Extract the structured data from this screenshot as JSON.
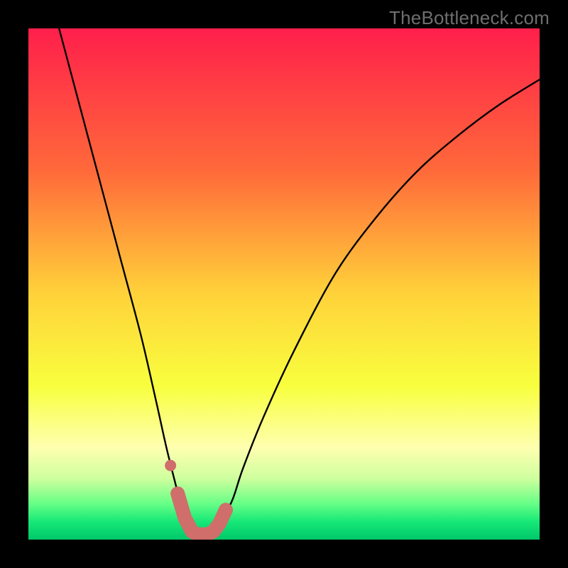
{
  "watermark": "TheBottleneck.com",
  "colors": {
    "black": "#000000",
    "curve": "#000000",
    "marker": "#cf6e6b",
    "gradient_stops": [
      {
        "offset": 0.0,
        "color": "#ff1f4b"
      },
      {
        "offset": 0.28,
        "color": "#ff6a3a"
      },
      {
        "offset": 0.52,
        "color": "#ffd23a"
      },
      {
        "offset": 0.7,
        "color": "#f8ff3e"
      },
      {
        "offset": 0.82,
        "color": "#feffb0"
      },
      {
        "offset": 0.88,
        "color": "#cfff9e"
      },
      {
        "offset": 0.93,
        "color": "#66ff86"
      },
      {
        "offset": 0.965,
        "color": "#17e877"
      },
      {
        "offset": 1.0,
        "color": "#00c86a"
      }
    ]
  },
  "chart_data": {
    "type": "line",
    "title": "",
    "xlabel": "",
    "ylabel": "",
    "xlim": [
      0,
      100
    ],
    "ylim": [
      0,
      100
    ],
    "grid": false,
    "legend": false,
    "series": [
      {
        "name": "bottleneck-curve",
        "x": [
          6,
          10,
          14,
          18,
          22,
          25,
          27,
          29,
          30,
          31,
          32,
          33,
          34,
          35,
          36,
          37,
          38,
          40,
          42,
          46,
          52,
          60,
          68,
          76,
          84,
          92,
          100
        ],
        "y": [
          100,
          85,
          70,
          55,
          40,
          27,
          18,
          10,
          6,
          3,
          1.5,
          1,
          1,
          1,
          1.5,
          2.5,
          4,
          8,
          14,
          24,
          37,
          52,
          63,
          72,
          79,
          85,
          90
        ]
      }
    ],
    "markers": [
      {
        "name": "highlight-dots",
        "x": [
          29.2,
          30.6,
          32.0,
          33.0,
          34.0,
          35.0,
          36.2,
          37.4,
          38.6
        ],
        "y": [
          9.0,
          4.2,
          1.6,
          1.0,
          1.0,
          1.0,
          1.6,
          3.2,
          5.8
        ]
      },
      {
        "name": "outlier-dot",
        "x": [
          27.8
        ],
        "y": [
          14.5
        ]
      }
    ],
    "annotations": []
  }
}
